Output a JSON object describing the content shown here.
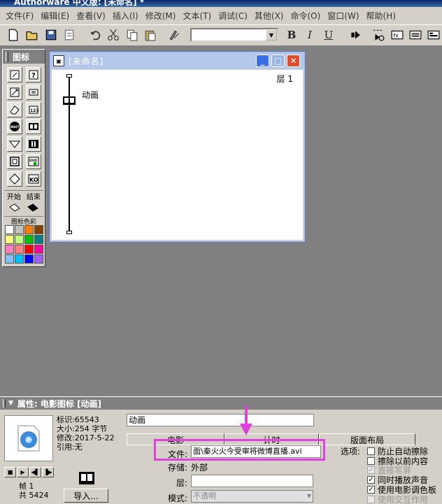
{
  "app": {
    "title": "Authorware 中文版: [未命名] *"
  },
  "menu": [
    "文件(F)",
    "编辑(E)",
    "查看(V)",
    "插入(I)",
    "修改(M)",
    "文本(T)",
    "调试(C)",
    "其他(X)",
    "命令(O)",
    "窗口(W)",
    "帮助(H)"
  ],
  "toolbar": {
    "buttons": [
      "new-icon",
      "open-icon",
      "save-all-icon",
      "import-icon",
      "undo-icon",
      "cut-icon",
      "copy-icon",
      "paste-icon",
      "find-icon",
      "bold-icon",
      "italic-icon",
      "underline-icon",
      "run-icon",
      "control-panel-icon",
      "functions-icon",
      "variables-icon",
      "knowledge-objects-icon"
    ],
    "bold": "B",
    "italic": "I",
    "underline": "U",
    "style_combo_value": ""
  },
  "palette": {
    "title": "图标",
    "icons": [
      "display-icon",
      "interaction-icon",
      "motion-icon",
      "calculation-icon",
      "erase-icon",
      "map-icon",
      "wait-icon",
      "digital-movie-icon",
      "navigate-icon",
      "sound-icon",
      "framework-icon",
      "video-icon",
      "decision-icon",
      "knowledge-object-icon"
    ],
    "wait_text": "WAIT",
    "dvd_text": "DVD",
    "ko_text": "KO",
    "start_label": "开始",
    "end_label": "结束",
    "color_label": "图标色彩",
    "colors": [
      "#ffffff",
      "#c0c0c0",
      "#ff8000",
      "#804000",
      "#ffff80",
      "#c0ff80",
      "#00c000",
      "#008080",
      "#ff80c0",
      "#ff8080",
      "#ff0000",
      "#ff00a0",
      "#80c0ff",
      "#00c0ff",
      "#0000ff",
      "#a060ff"
    ]
  },
  "flowline_window": {
    "title": "[未命名]",
    "layer": "层 1",
    "icon_label": "动画"
  },
  "properties": {
    "header": "属性: 电影图标 [动画]",
    "info": {
      "id": "标识:65543",
      "size": "大小:254 字节",
      "modified": "修改:2017-5-22",
      "refs": "引用:无"
    },
    "frame": "帧 1",
    "total": "共 5424",
    "import_label": "导入...",
    "name_value": "动画",
    "tabs": [
      "电影",
      "计时",
      "版面布局"
    ],
    "file_label": "文件:",
    "file_value": "面\\秦火火今受审将微博直播.avi",
    "storage_label": "存储:",
    "storage_value": "外部",
    "layer_label": "层:",
    "layer_value": "",
    "mode_label": "模式:",
    "mode_value": "不透明",
    "options_label": "选项:",
    "options": [
      {
        "label": "防止自动擦除",
        "checked": false,
        "enabled": true
      },
      {
        "label": "擦除以前内容",
        "checked": false,
        "enabled": true
      },
      {
        "label": "直接写屏",
        "checked": true,
        "enabled": false
      },
      {
        "label": "同时播放声音",
        "checked": true,
        "enabled": true
      },
      {
        "label": "使用电影调色板",
        "checked": true,
        "enabled": true
      },
      {
        "label": "使用交互作用",
        "checked": false,
        "enabled": false
      }
    ]
  },
  "colors": {
    "highlight": "#e040e0",
    "titlebar": "#0a246a",
    "window_title": "#b5c8ec"
  }
}
